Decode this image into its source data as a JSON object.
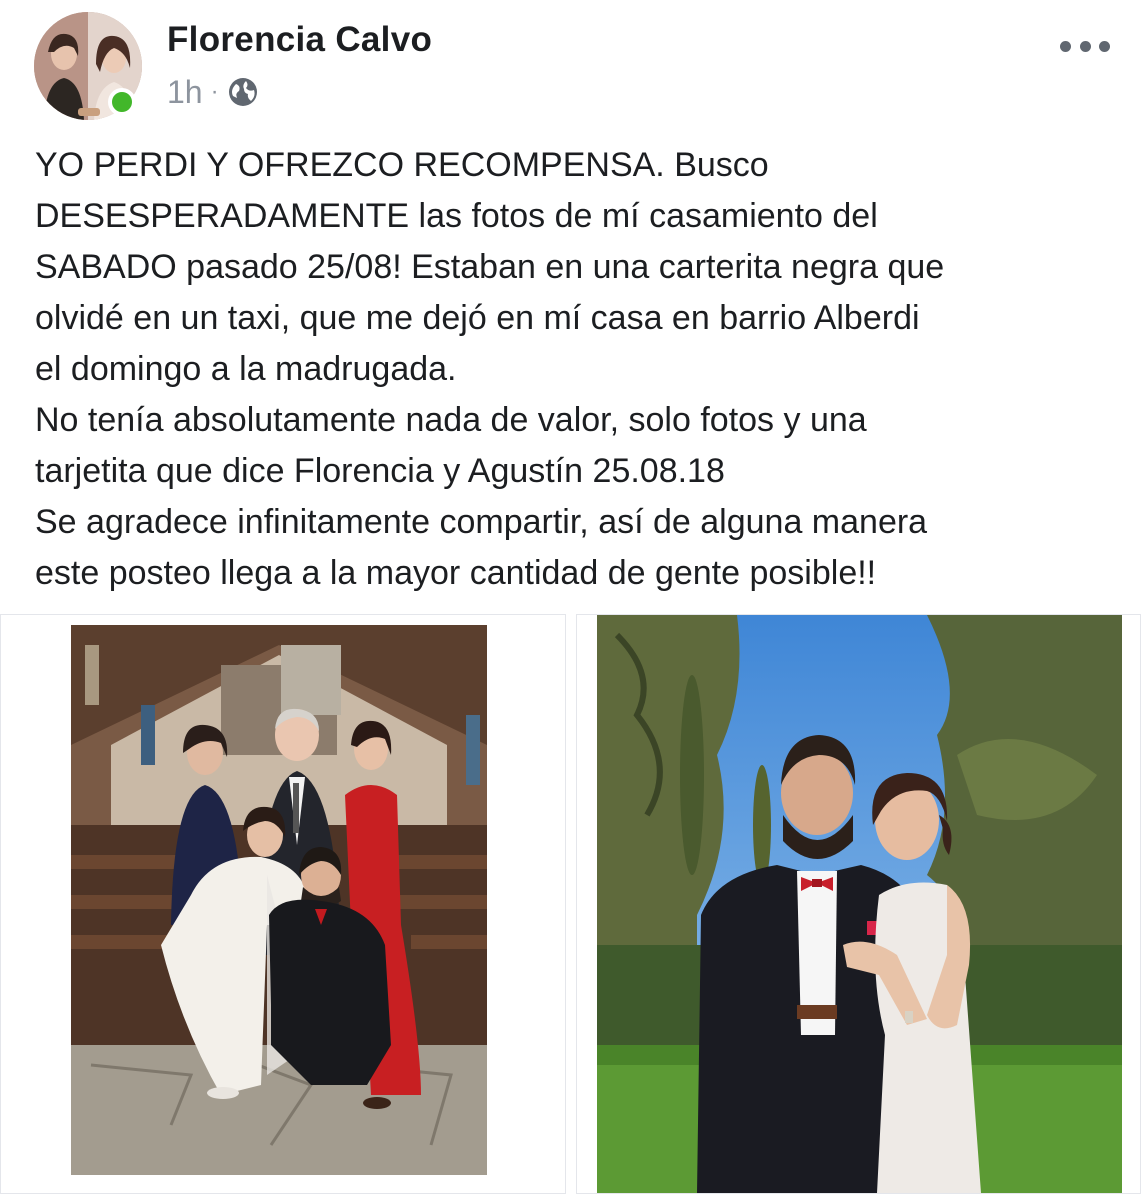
{
  "post": {
    "author": "Florencia Calvo",
    "time": "1h",
    "separator": "·",
    "privacy_icon": "globe-icon",
    "menu_icon": "more-icon",
    "online_color": "#42b72a",
    "text_lines": [
      "YO PERDI Y OFREZCO RECOMPENSA. Busco",
      "DESESPERADAMENTE las fotos de mí casamiento del",
      "SABADO pasado 25/08! Estaban en una carterita negra que",
      "olvidé en un taxi, que me dejó en mí casa en barrio Alberdi",
      "el domingo a la madrugada.",
      "No tenía absolutamente nada de valor, solo fotos y una",
      "tarjetita que dice Florencia y Agustín 25.08.18",
      "Se agradece infinitamente compartir, así de alguna manera",
      "este posteo llega a la mayor cantidad de gente posible!!"
    ]
  },
  "photos": [
    {
      "name": "church-group-photo"
    },
    {
      "name": "couple-outdoor-photo"
    }
  ]
}
